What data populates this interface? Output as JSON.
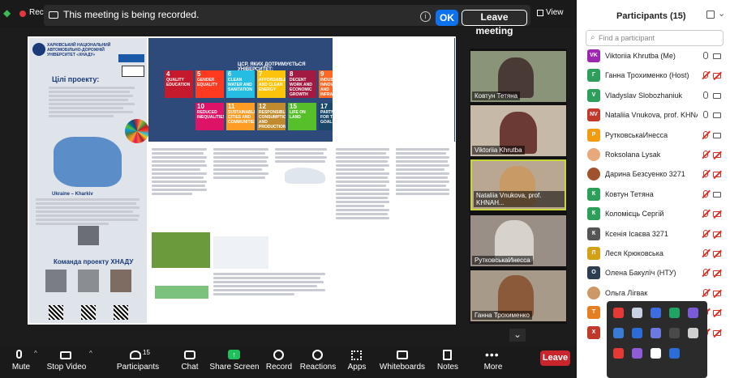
{
  "top_bar": {
    "recording_label": "Reco",
    "banner_text": "This meeting is being recorded.",
    "ok_label": "OK",
    "leave_meeting_label": "Leave meeting",
    "view_label": "View"
  },
  "shared_doc": {
    "page1": {
      "university": "ХАРКІВСЬКИЙ НАЦІОНАЛЬНИЙ АВТОМОБІЛЬНО-ДОРОЖНІЙ УНІВЕРСИТЕТ «ХНАДУ»",
      "goal_heading": "Цілі проекту:",
      "map_caption": "Ukraine – Kharkiv",
      "team_heading": "Команда проекту ХНАДУ"
    },
    "page2": {
      "sdg_heading": "ЦСР, ЯКИХ ДОТРИМУЄТЬСЯ УНІВЕРСИТЕТ:",
      "sdg_goals": [
        {
          "num": "4",
          "label": "QUALITY EDUCATION",
          "color": "#c5192d"
        },
        {
          "num": "5",
          "label": "GENDER EQUALITY",
          "color": "#ff3a21"
        },
        {
          "num": "6",
          "label": "CLEAN WATER AND SANITATION",
          "color": "#26bde2"
        },
        {
          "num": "7",
          "label": "AFFORDABLE AND CLEAN ENERGY",
          "color": "#fcc30b"
        },
        {
          "num": "8",
          "label": "DECENT WORK AND ECONOMIC GROWTH",
          "color": "#a21942"
        },
        {
          "num": "9",
          "label": "INDUSTRY, INNOVATION AND INFRASTRUCTURE",
          "color": "#fd6925"
        },
        {
          "num": "10",
          "label": "REDUCED INEQUALITIES",
          "color": "#dd1367"
        },
        {
          "num": "11",
          "label": "SUSTAINABLE CITIES AND COMMUNITIES",
          "color": "#fd9d24"
        },
        {
          "num": "12",
          "label": "RESPONSIBLE CONSUMPTION AND PRODUCTION",
          "color": "#bf8b2e"
        },
        {
          "num": "15",
          "label": "LIFE ON LAND",
          "color": "#56c02b"
        },
        {
          "num": "17",
          "label": "PARTNERSHIPS FOR THE GOALS",
          "color": "#19486a"
        }
      ]
    }
  },
  "tiles": [
    {
      "name": "Ковтун Тетяна"
    },
    {
      "name": "Viktoriia Khrutba"
    },
    {
      "name": "Nataliia Vnukova, prof. KHNAH..."
    },
    {
      "name": "РутковськаИнесса"
    },
    {
      "name": "Ганна Трохименко"
    }
  ],
  "toolbar": {
    "mute": "Mute",
    "stop_video": "Stop Video",
    "participants": "Participants",
    "participants_count": "15",
    "chat": "Chat",
    "share_screen": "Share Screen",
    "record": "Record",
    "reactions": "Reactions",
    "apps": "Apps",
    "whiteboards": "Whiteboards",
    "notes": "Notes",
    "more": "More",
    "leave": "Leave"
  },
  "panel": {
    "title": "Participants (15)",
    "search_placeholder": "Find a participant",
    "participants": [
      {
        "initials": "VK",
        "name": "Viktoriia Khrutba (Me)",
        "color": "#9c27b0",
        "mic": "on",
        "cam": "on"
      },
      {
        "initials": "Г",
        "name": "Ганна Трохименко (Host)",
        "color": "#2e9e5b",
        "mic": "muted",
        "cam": "off"
      },
      {
        "initials": "V",
        "name": "Vladyslav Slobozhaniuk",
        "color": "#2e9e5b",
        "mic": "on",
        "cam": "on"
      },
      {
        "initials": "NV",
        "name": "Nataliia Vnukova, prof. KHNAHU...",
        "color": "#c0392b",
        "mic": "on",
        "cam": "on"
      },
      {
        "initials": "Р",
        "name": "РутковськаИнесса",
        "color": "#f39c12",
        "mic": "muted",
        "cam": "on"
      },
      {
        "initials": "",
        "name": "Roksolana Lysak",
        "color": "#e8a87c",
        "mic": "muted",
        "cam": "off"
      },
      {
        "initials": "",
        "name": "Дарина Безсуенко 3271",
        "color": "#a0522d",
        "mic": "muted",
        "cam": "off"
      },
      {
        "initials": "К",
        "name": "Ковтун Тетяна",
        "color": "#2e9e5b",
        "mic": "muted",
        "cam": "on"
      },
      {
        "initials": "К",
        "name": "Коломієць Сергій",
        "color": "#2e9e5b",
        "mic": "muted",
        "cam": "off"
      },
      {
        "initials": "К",
        "name": "Ксенія Ісаєва 3271",
        "color": "#555555",
        "mic": "muted",
        "cam": "off"
      },
      {
        "initials": "Л",
        "name": "Леся Крюковська",
        "color": "#d4a017",
        "mic": "muted",
        "cam": "off"
      },
      {
        "initials": "О",
        "name": "Олена Бакулїч (НТУ)",
        "color": "#2c3e50",
        "mic": "muted",
        "cam": "off"
      },
      {
        "initials": "",
        "name": "Ольга Лігвак",
        "color": "#cc9966",
        "mic": "muted",
        "cam": "off"
      },
      {
        "initials": "Т",
        "name": "",
        "color": "#e67e22",
        "mic": "muted",
        "cam": "off"
      },
      {
        "initials": "Х",
        "name": "",
        "color": "#c0392b",
        "mic": "muted",
        "cam": "off"
      }
    ]
  }
}
